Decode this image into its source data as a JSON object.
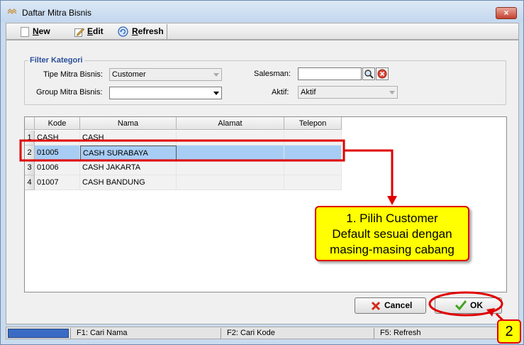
{
  "window": {
    "title": "Daftar Mitra Bisnis",
    "close_label": "×"
  },
  "toolbar": {
    "new_label_first": "N",
    "new_label_rest": "ew",
    "edit_label_first": "E",
    "edit_label_rest": "dit",
    "refresh_label_first": "R",
    "refresh_label_rest": "efresh"
  },
  "filter": {
    "legend": "Filter Kategori",
    "tipe_label": "Tipe Mitra Bisnis:",
    "tipe_value": "Customer",
    "group_label": "Group Mitra Bisnis:",
    "group_value": "",
    "salesman_label": "Salesman:",
    "salesman_value": "",
    "aktif_label": "Aktif:",
    "aktif_value": "Aktif"
  },
  "grid": {
    "columns": [
      "Kode",
      "Nama",
      "Alamat",
      "Telepon"
    ],
    "rows": [
      {
        "num": "1",
        "kode": "CASH",
        "nama": "CASH",
        "alamat": "",
        "telepon": ""
      },
      {
        "num": "2",
        "kode": "01005",
        "nama": "CASH SURABAYA",
        "alamat": "",
        "telepon": ""
      },
      {
        "num": "3",
        "kode": "01006",
        "nama": "CASH JAKARTA",
        "alamat": "",
        "telepon": ""
      },
      {
        "num": "4",
        "kode": "01007",
        "nama": "CASH BANDUNG",
        "alamat": "",
        "telepon": ""
      }
    ],
    "selected_row": 2
  },
  "buttons": {
    "cancel_first": "C",
    "cancel_rest": "ancel",
    "ok_first": "O",
    "ok_rest": "K"
  },
  "statusbar": {
    "f1": "F1: Cari Nama",
    "f2": "F2: Cari Kode",
    "f5": "F5: Refresh"
  },
  "annotation": {
    "callout_line1": "1. Pilih Customer",
    "callout_line2": "Default sesuai dengan",
    "callout_line3": "masing-masing cabang",
    "badge": "2"
  },
  "colors": {
    "accent": "#e00000",
    "highlight": "#ffff00",
    "selection": "#a8cdf4"
  }
}
